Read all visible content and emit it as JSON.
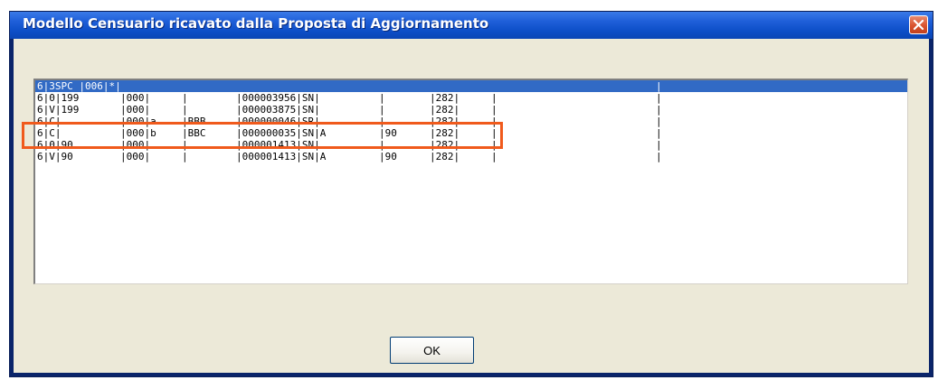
{
  "window": {
    "title": "Modello Censuario ricavato dalla Proposta di Aggiornamento",
    "close_icon": "close-icon"
  },
  "list": {
    "rows": [
      {
        "selected": true,
        "cells": [
          "6|3SPC |006|*|",
          "",
          "",
          "",
          "",
          "",
          "",
          "|"
        ]
      },
      {
        "selected": false,
        "cells": [
          "6|0|199",
          "|000|",
          "|",
          "|000003956|SN|",
          "|",
          "|282|",
          "|",
          "|"
        ]
      },
      {
        "selected": false,
        "cells": [
          "6|V|199",
          "|000|",
          "|",
          "|000003875|SN|",
          "|",
          "|282|",
          "|",
          "|"
        ]
      },
      {
        "selected": false,
        "cells": [
          "6|C|",
          "|000|a",
          "|BBB",
          "|000000046|SR|",
          "|",
          "|282|",
          "|",
          "|"
        ]
      },
      {
        "selected": false,
        "cells": [
          "6|C|",
          "|000|b",
          "|BBC",
          "|000000035|SN|A",
          "|90",
          "|282|",
          "|",
          "|"
        ]
      },
      {
        "selected": false,
        "cells": [
          "6|0|90",
          "|000|",
          "|",
          "|000001413|SN|",
          "|",
          "|282|",
          "|",
          "|"
        ]
      },
      {
        "selected": false,
        "cells": [
          "6|V|90",
          "|000|",
          "|",
          "|000001413|SN|A",
          "|90",
          "|282|",
          "|",
          "|"
        ]
      }
    ]
  },
  "buttons": {
    "ok_label": "OK"
  },
  "annotation": {
    "color": "#f05a1c"
  }
}
